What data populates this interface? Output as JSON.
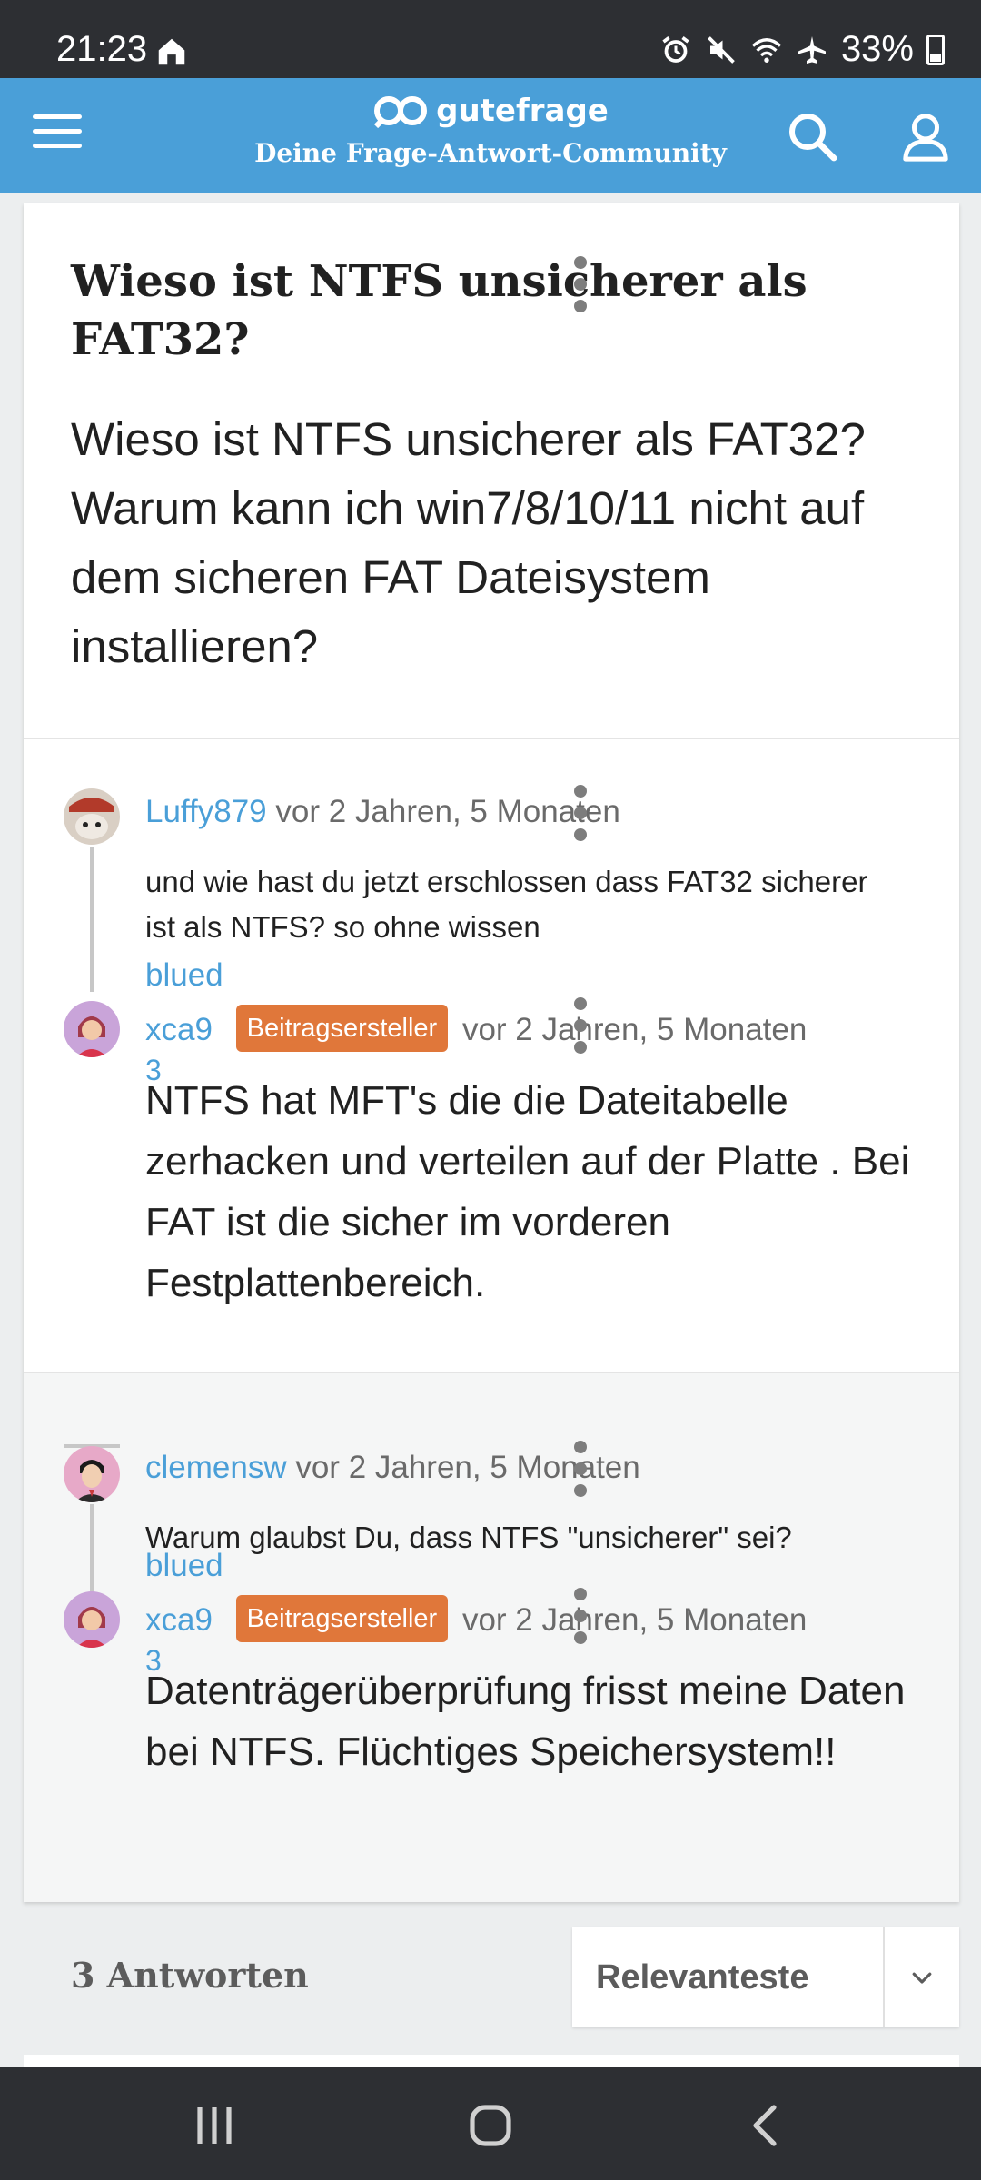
{
  "status_bar": {
    "time": "21:23",
    "battery": "33%",
    "icons": [
      "home-icon",
      "alarm-icon",
      "mute-icon",
      "wifi-icon",
      "airplane-icon",
      "battery-icon"
    ]
  },
  "app_bar": {
    "brand": "gutefrage",
    "tagline": "Deine Frage-Antwort-Community",
    "accent_color": "#4a9fd8"
  },
  "question": {
    "title": "Wieso ist NTFS unsicherer als FAT32?",
    "body": "Wieso ist NTFS unsicherer als FAT32? Warum kann ich win7/8/10/11 nicht auf dem sicheren FAT Dateisystem installieren?"
  },
  "threads": [
    {
      "comment": {
        "user": "Luffy879",
        "time": "vor 2 Jahren, 5 Monaten",
        "text": "und wie hast du jetzt erschlossen dass FAT32 sicherer ist als NTFS? so ohne wissen"
      },
      "reply": {
        "user_line1": "blued",
        "user_line2": "xca9",
        "user_line3": "3",
        "badge": "Beitragsersteller",
        "time": "vor 2 Jahren, 5 Monaten",
        "text": "NTFS hat MFT's die die Dateitabelle zerhacken und verteilen auf der Platte . Bei FAT ist die sicher im vorderen Festplattenbereich."
      }
    },
    {
      "comment": {
        "user": "clemensw",
        "time": "vor 2 Jahren, 5 Monaten",
        "text": "Warum glaubst Du, dass NTFS \"unsicherer\" sei?"
      },
      "reply": {
        "user_line1": "blued",
        "user_line2": "xca9",
        "user_line3": "3",
        "badge": "Beitragsersteller",
        "time": "vor 2 Jahren, 5 Monaten",
        "text": "Datenträgerüberprüfung frisst meine Daten bei NTFS. Flüchtiges Speichersystem!!"
      }
    }
  ],
  "answers_bar": {
    "count_label": "3 Antworten",
    "sort_selected": "Relevanteste"
  }
}
